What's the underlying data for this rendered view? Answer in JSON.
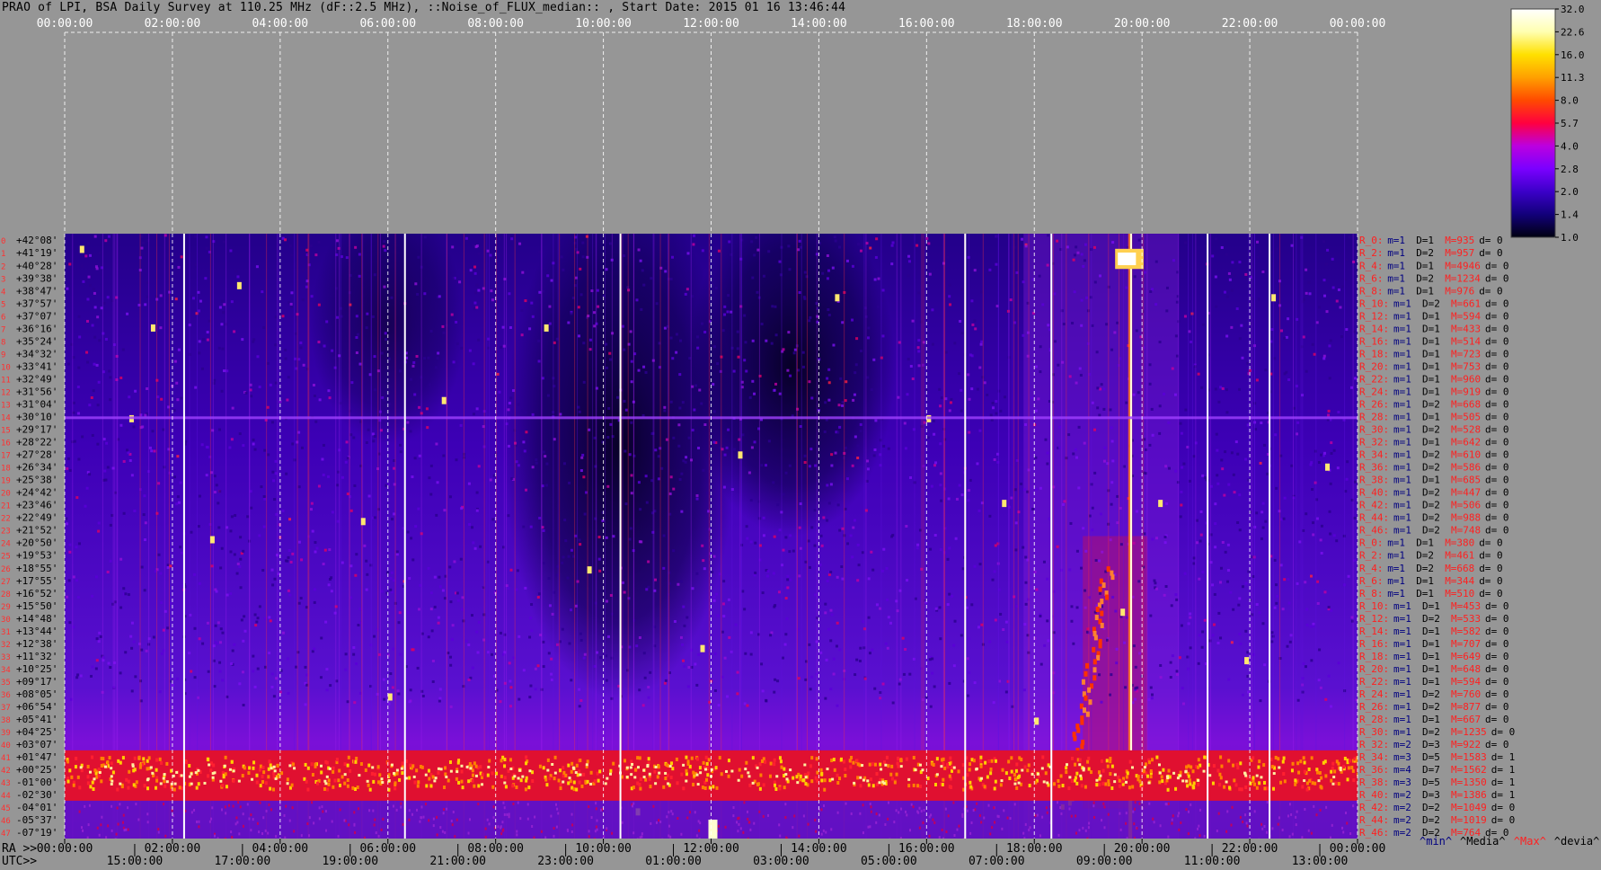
{
  "title": "PRAO of LPI, BSA Daily Survey at 110.25 MHz (dF::2.5 MHz), ::Noise_of_FLUX_median:: , Start Date: 2015 01 16 13:46:44",
  "chart_data": {
    "type": "heatmap",
    "title": "PRAO of LPI, BSA Daily Survey at 110.25 MHz (dF::2.5 MHz), ::Noise_of_FLUX_median:: , Start Date: 2015 01 16 13:46:44",
    "top_axis_ticks": [
      "00:00:00",
      "02:00:00",
      "04:00:00",
      "06:00:00",
      "08:00:00",
      "10:00:00",
      "12:00:00",
      "14:00:00",
      "16:00:00",
      "18:00:00",
      "20:00:00",
      "22:00:00",
      "00:00:00"
    ],
    "bottom_axis_ra_label": "RA >>",
    "bottom_axis_ra_ticks": [
      "00:00:00",
      "02:00:00",
      "04:00:00",
      "06:00:00",
      "08:00:00",
      "10:00:00",
      "12:00:00",
      "14:00:00",
      "16:00:00",
      "18:00:00",
      "20:00:00",
      "22:00:00",
      "00:00:00"
    ],
    "bottom_axis_utc_label": "UTC>>",
    "bottom_axis_utc_ticks": [
      "15:00:00",
      "17:00:00",
      "19:00:00",
      "21:00:00",
      "23:00:00",
      "01:00:00",
      "03:00:00",
      "05:00:00",
      "07:00:00",
      "09:00:00",
      "11:00:00",
      "13:00:00"
    ],
    "declinations": [
      "+42°08'",
      "+41°19'",
      "+40°28'",
      "+39°38'",
      "+38°47'",
      "+37°57'",
      "+37°07'",
      "+36°16'",
      "+35°24'",
      "+34°32'",
      "+33°41'",
      "+32°49'",
      "+31°56'",
      "+31°04'",
      "+30°10'",
      "+29°17'",
      "+28°22'",
      "+27°28'",
      "+26°34'",
      "+25°38'",
      "+24°42'",
      "+23°46'",
      "+22°49'",
      "+21°52'",
      "+20°50'",
      "+19°53'",
      "+18°55'",
      "+17°55'",
      "+16°52'",
      "+15°50'",
      "+14°48'",
      "+13°44'",
      "+12°38'",
      "+11°32'",
      "+10°25'",
      "+09°17'",
      "+08°05'",
      "+06°54'",
      "+05°41'",
      "+04°25'",
      "+03°07'",
      "+01°47'",
      "+00°25'",
      "-01°00'",
      "-02°30'",
      "-04°01'",
      "-05°37'",
      "-07°19'"
    ],
    "beam_numbers": [
      "0",
      "1",
      "2",
      "3",
      "4",
      "5",
      "6",
      "7",
      "8",
      "9",
      "10",
      "11",
      "12",
      "13",
      "14",
      "15",
      "16",
      "17",
      "18",
      "19",
      "20",
      "21",
      "22",
      "23",
      "24",
      "25",
      "26",
      "27",
      "28",
      "29",
      "30",
      "31",
      "32",
      "33",
      "34",
      "35",
      "36",
      "37",
      "38",
      "39",
      "40",
      "41",
      "42",
      "43",
      "44",
      "45",
      "46",
      "47"
    ],
    "beam_stats": [
      {
        "r": "R_0:",
        "m": "m=1",
        "d": "D=1",
        "max": "M=935",
        "dev": "d= 0"
      },
      {
        "r": "R_2:",
        "m": "m=1",
        "d": "D=2",
        "max": "M=957",
        "dev": "d= 0"
      },
      {
        "r": "R_4:",
        "m": "m=1",
        "d": "D=1",
        "max": "M=4946",
        "dev": "d= 0"
      },
      {
        "r": "R_6:",
        "m": "m=1",
        "d": "D=2",
        "max": "M=1234",
        "dev": "d= 0"
      },
      {
        "r": "R_8:",
        "m": "m=1",
        "d": "D=1",
        "max": "M=976",
        "dev": "d= 0"
      },
      {
        "r": "R_10:",
        "m": "m=1",
        "d": "D=2",
        "max": "M=661",
        "dev": "d= 0"
      },
      {
        "r": "R_12:",
        "m": "m=1",
        "d": "D=1",
        "max": "M=594",
        "dev": "d= 0"
      },
      {
        "r": "R_14:",
        "m": "m=1",
        "d": "D=1",
        "max": "M=433",
        "dev": "d= 0"
      },
      {
        "r": "R_16:",
        "m": "m=1",
        "d": "D=1",
        "max": "M=514",
        "dev": "d= 0"
      },
      {
        "r": "R_18:",
        "m": "m=1",
        "d": "D=1",
        "max": "M=723",
        "dev": "d= 0"
      },
      {
        "r": "R_20:",
        "m": "m=1",
        "d": "D=1",
        "max": "M=753",
        "dev": "d= 0"
      },
      {
        "r": "R_22:",
        "m": "m=1",
        "d": "D=1",
        "max": "M=960",
        "dev": "d= 0"
      },
      {
        "r": "R_24:",
        "m": "m=1",
        "d": "D=1",
        "max": "M=919",
        "dev": "d= 0"
      },
      {
        "r": "R_26:",
        "m": "m=1",
        "d": "D=2",
        "max": "M=668",
        "dev": "d= 0"
      },
      {
        "r": "R_28:",
        "m": "m=1",
        "d": "D=1",
        "max": "M=505",
        "dev": "d= 0"
      },
      {
        "r": "R_30:",
        "m": "m=1",
        "d": "D=2",
        "max": "M=528",
        "dev": "d= 0"
      },
      {
        "r": "R_32:",
        "m": "m=1",
        "d": "D=1",
        "max": "M=642",
        "dev": "d= 0"
      },
      {
        "r": "R_34:",
        "m": "m=1",
        "d": "D=2",
        "max": "M=610",
        "dev": "d= 0"
      },
      {
        "r": "R_36:",
        "m": "m=1",
        "d": "D=2",
        "max": "M=586",
        "dev": "d= 0"
      },
      {
        "r": "R_38:",
        "m": "m=1",
        "d": "D=1",
        "max": "M=685",
        "dev": "d= 0"
      },
      {
        "r": "R_40:",
        "m": "m=1",
        "d": "D=2",
        "max": "M=447",
        "dev": "d= 0"
      },
      {
        "r": "R_42:",
        "m": "m=1",
        "d": "D=2",
        "max": "M=506",
        "dev": "d= 0"
      },
      {
        "r": "R_44:",
        "m": "m=1",
        "d": "D=2",
        "max": "M=988",
        "dev": "d= 0"
      },
      {
        "r": "R_46:",
        "m": "m=1",
        "d": "D=2",
        "max": "M=748",
        "dev": "d= 0"
      },
      {
        "r": "R_0:",
        "m": "m=1",
        "d": "D=1",
        "max": "M=380",
        "dev": "d= 0"
      },
      {
        "r": "R_2:",
        "m": "m=1",
        "d": "D=2",
        "max": "M=461",
        "dev": "d= 0"
      },
      {
        "r": "R_4:",
        "m": "m=1",
        "d": "D=2",
        "max": "M=668",
        "dev": "d= 0"
      },
      {
        "r": "R_6:",
        "m": "m=1",
        "d": "D=1",
        "max": "M=344",
        "dev": "d= 0"
      },
      {
        "r": "R_8:",
        "m": "m=1",
        "d": "D=1",
        "max": "M=510",
        "dev": "d= 0"
      },
      {
        "r": "R_10:",
        "m": "m=1",
        "d": "D=1",
        "max": "M=453",
        "dev": "d= 0"
      },
      {
        "r": "R_12:",
        "m": "m=1",
        "d": "D=2",
        "max": "M=533",
        "dev": "d= 0"
      },
      {
        "r": "R_14:",
        "m": "m=1",
        "d": "D=1",
        "max": "M=582",
        "dev": "d= 0"
      },
      {
        "r": "R_16:",
        "m": "m=1",
        "d": "D=1",
        "max": "M=707",
        "dev": "d= 0"
      },
      {
        "r": "R_18:",
        "m": "m=1",
        "d": "D=1",
        "max": "M=649",
        "dev": "d= 0"
      },
      {
        "r": "R_20:",
        "m": "m=1",
        "d": "D=1",
        "max": "M=648",
        "dev": "d= 0"
      },
      {
        "r": "R_22:",
        "m": "m=1",
        "d": "D=1",
        "max": "M=594",
        "dev": "d= 0"
      },
      {
        "r": "R_24:",
        "m": "m=1",
        "d": "D=2",
        "max": "M=760",
        "dev": "d= 0"
      },
      {
        "r": "R_26:",
        "m": "m=1",
        "d": "D=2",
        "max": "M=877",
        "dev": "d= 0"
      },
      {
        "r": "R_28:",
        "m": "m=1",
        "d": "D=1",
        "max": "M=667",
        "dev": "d= 0"
      },
      {
        "r": "R_30:",
        "m": "m=1",
        "d": "D=2",
        "max": "M=1235",
        "dev": "d= 0"
      },
      {
        "r": "R_32:",
        "m": "m=2",
        "d": "D=3",
        "max": "M=922",
        "dev": "d= 0"
      },
      {
        "r": "R_34:",
        "m": "m=3",
        "d": "D=5",
        "max": "M=1583",
        "dev": "d= 1"
      },
      {
        "r": "R_36:",
        "m": "m=4",
        "d": "D=7",
        "max": "M=1562",
        "dev": "d= 1"
      },
      {
        "r": "R_38:",
        "m": "m=3",
        "d": "D=5",
        "max": "M=1350",
        "dev": "d= 1"
      },
      {
        "r": "R_40:",
        "m": "m=2",
        "d": "D=3",
        "max": "M=1386",
        "dev": "d= 1"
      },
      {
        "r": "R_42:",
        "m": "m=2",
        "d": "D=2",
        "max": "M=1049",
        "dev": "d= 0"
      },
      {
        "r": "R_44:",
        "m": "m=2",
        "d": "D=2",
        "max": "M=1019",
        "dev": "d= 0"
      },
      {
        "r": "R_46:",
        "m": "m=2",
        "d": "D=2",
        "max": "M=764",
        "dev": "d= 0"
      }
    ],
    "stats_legend": [
      {
        "text": "^min^",
        "color": "#000080"
      },
      {
        "text": "^Media^",
        "color": "#000000"
      },
      {
        "text": "^Max^",
        "color": "#ff2020"
      },
      {
        "text": "^devia^",
        "color": "#000000"
      }
    ],
    "colorbar": {
      "ticks": [
        "32.0",
        "22.6",
        "16.0",
        "11.3",
        "8.0",
        "5.7",
        "4.0",
        "2.8",
        "2.0",
        "1.4",
        "1.0"
      ],
      "stops": [
        "#000010",
        "#12007a",
        "#3b00c8",
        "#7a00ff",
        "#bb00e0",
        "#ff0040",
        "#ff4a00",
        "#ffa000",
        "#ffe000",
        "#ffffb0",
        "#ffffff"
      ]
    },
    "features": {
      "bright_band_declinations": [
        "+01°47'",
        "-01°00'"
      ],
      "strong_source_ra": "19:48",
      "strong_source_dec": "+41°19'"
    }
  }
}
